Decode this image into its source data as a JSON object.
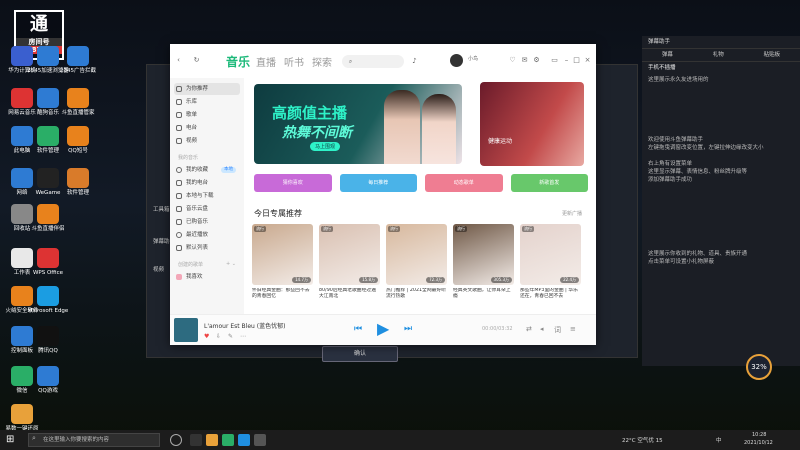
{
  "overlay": {
    "watermark_char": "通",
    "room_label": "房间号",
    "room_number": "4487673"
  },
  "desktop": {
    "icons": [
      {
        "label": "华为计算机",
        "color": "#3a5fcf"
      },
      {
        "label": "网易云音乐",
        "color": "#d33"
      },
      {
        "label": "此电脑",
        "color": "#2e7bd3"
      },
      {
        "label": "网络",
        "color": "#2e7bd3"
      },
      {
        "label": "回收站",
        "color": "#888"
      },
      {
        "label": "工作表",
        "color": "#e8e8e8"
      },
      {
        "label": "火绒安全软件",
        "color": "#e8821c"
      },
      {
        "label": "控制面板",
        "color": "#2e7bd3"
      },
      {
        "label": "微信",
        "color": "#2aae67"
      },
      {
        "label": "易数一键还原",
        "color": "#e8a13a"
      },
      {
        "label": "2345加速浏览器",
        "color": "#2e7bd3"
      },
      {
        "label": "酷狗音乐",
        "color": "#2e7bd3"
      },
      {
        "label": "软件管理",
        "color": "#2aae67"
      },
      {
        "label": "WeGame",
        "color": "#222"
      },
      {
        "label": "斗鱼直播伴侣",
        "color": "#e8821c"
      },
      {
        "label": "WPS Office",
        "color": "#d33"
      },
      {
        "label": "Microsoft Edge",
        "color": "#1b9de2"
      },
      {
        "label": "腾讯QQ",
        "color": "#111"
      },
      {
        "label": "QQ游戏",
        "color": "#2e7bd3"
      },
      {
        "label": "2345广告拦截",
        "color": "#2e7bd3"
      },
      {
        "label": "斗鱼直播管家",
        "color": "#e8821c"
      },
      {
        "label": "QQ短号",
        "color": "#e8821c"
      },
      {
        "label": "软件管理",
        "color": "#d97b2a"
      }
    ]
  },
  "bgapp": {
    "text1": "工具箱",
    "text2": "弹幕助手",
    "text3": "视频",
    "confirm_label": "确认"
  },
  "chat": {
    "title": "弹幕助手",
    "tabs": [
      "弹幕",
      "礼物",
      "粘贴板"
    ],
    "header_note": "手机不插播",
    "messages": [
      "这里展示永久友进场用的",
      "欢迎使用斗鱼弹幕助手",
      "左键拖曳调窗改变位置，左键拉伸边缘改变大小",
      "右上角有设置菜单",
      "这里显示弹幕、表情信息、粉丝牌升级等",
      "添加弹幕助手成功",
      "这里展示你收到的礼物、道具、贵族开通",
      "点击菜单可设置小礼物屏蔽"
    ],
    "gauge": "32%"
  },
  "music": {
    "nav": [
      {
        "label": "音乐",
        "active": true
      },
      {
        "label": "直播",
        "active": false
      },
      {
        "label": "听书",
        "active": false
      },
      {
        "label": "探索",
        "active": false
      }
    ],
    "search_placeholder": "",
    "user_name": "小鸟",
    "sidebar": {
      "items": [
        {
          "label": "为你推荐",
          "active": true
        },
        {
          "label": "乐库"
        },
        {
          "label": "歌单"
        },
        {
          "label": "电台"
        },
        {
          "label": "视频"
        }
      ],
      "my_music_head": "我的音乐",
      "my_items": [
        {
          "label": "我的收藏",
          "badge": "本地"
        },
        {
          "label": "我的电台"
        },
        {
          "label": "本地与下载"
        },
        {
          "label": "音乐云盘"
        },
        {
          "label": "已购音乐"
        },
        {
          "label": "最近播放"
        },
        {
          "label": "默认列表"
        }
      ],
      "created_head": "创建的歌单",
      "created_items": [
        {
          "label": "我喜欢"
        }
      ]
    },
    "banner": {
      "title1": "高颜值主播",
      "title2": "热舞不间断",
      "button": "马上围观",
      "side_title": "健康运动"
    },
    "quick_cards": [
      {
        "label": "猜你喜欢",
        "color": "#c86ad8"
      },
      {
        "label": "每日推荐",
        "color": "#4ab3e8"
      },
      {
        "label": "动态歌单",
        "color": "#ef7d92"
      },
      {
        "label": "新歌首发",
        "color": "#68c86b"
      }
    ],
    "section_title": "今日专属推荐",
    "section_more": "更新广播",
    "recs": [
      {
        "tag": "流行",
        "plays": "14.7万",
        "caption": "怀旧经典金曲：那些回不去的青春回忆",
        "color": "#c9a98e"
      },
      {
        "tag": "流行",
        "plays": "15.8万",
        "caption": "80/90后经典老歌曲经过遍大江南北",
        "color": "#d9c0b1"
      },
      {
        "tag": "流行",
        "plays": "72.3万",
        "caption": "热门推荐 | 2021全网最好听流行热歌",
        "color": "#d7b89d"
      },
      {
        "tag": "流行",
        "plays": "305.3万",
        "caption": "经典英文歌曲，让你耳朵上瘾",
        "color": "#6f5846"
      },
      {
        "tag": "流行",
        "plays": "22.4万",
        "caption": "那些年MP3里的金曲 | 华乐还在，青春已回不去",
        "color": "#e4d2cc"
      }
    ],
    "player": {
      "song": "L'amour Est Bleu (蓝色忧郁)",
      "time": "00:00/03:32"
    }
  },
  "taskbar": {
    "search_placeholder": "在这里输入你要搜索的内容",
    "weather": "22°C 空气优 15",
    "lang": "中",
    "time": "10:28",
    "date": "2021/10/12"
  }
}
